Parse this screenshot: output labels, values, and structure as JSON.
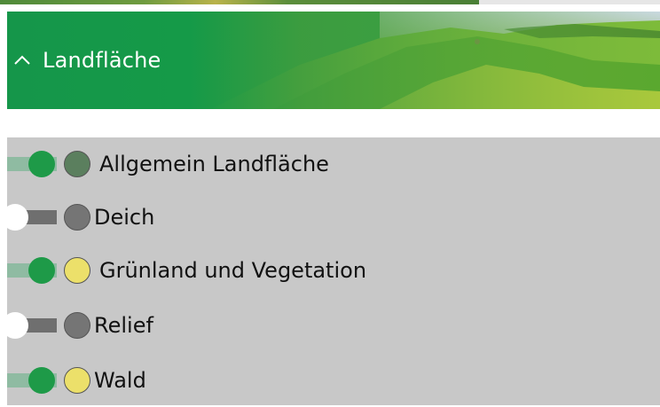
{
  "section": {
    "title": "Landfläche",
    "expanded": true,
    "colors": {
      "banner": "#1a9a4a",
      "accent": "#1e9a48"
    }
  },
  "layers": [
    {
      "label": "Allgemein Landfläche",
      "enabled": true,
      "dot_color": "#5b7f5e"
    },
    {
      "label": "Deich",
      "enabled": false,
      "dot_color": "#757575"
    },
    {
      "label": "Grünland und Vegetation",
      "enabled": true,
      "dot_color": "#ece06a"
    },
    {
      "label": "Relief",
      "enabled": false,
      "dot_color": "#757575"
    },
    {
      "label": "Wald",
      "enabled": true,
      "dot_color": "#ece06a"
    }
  ]
}
